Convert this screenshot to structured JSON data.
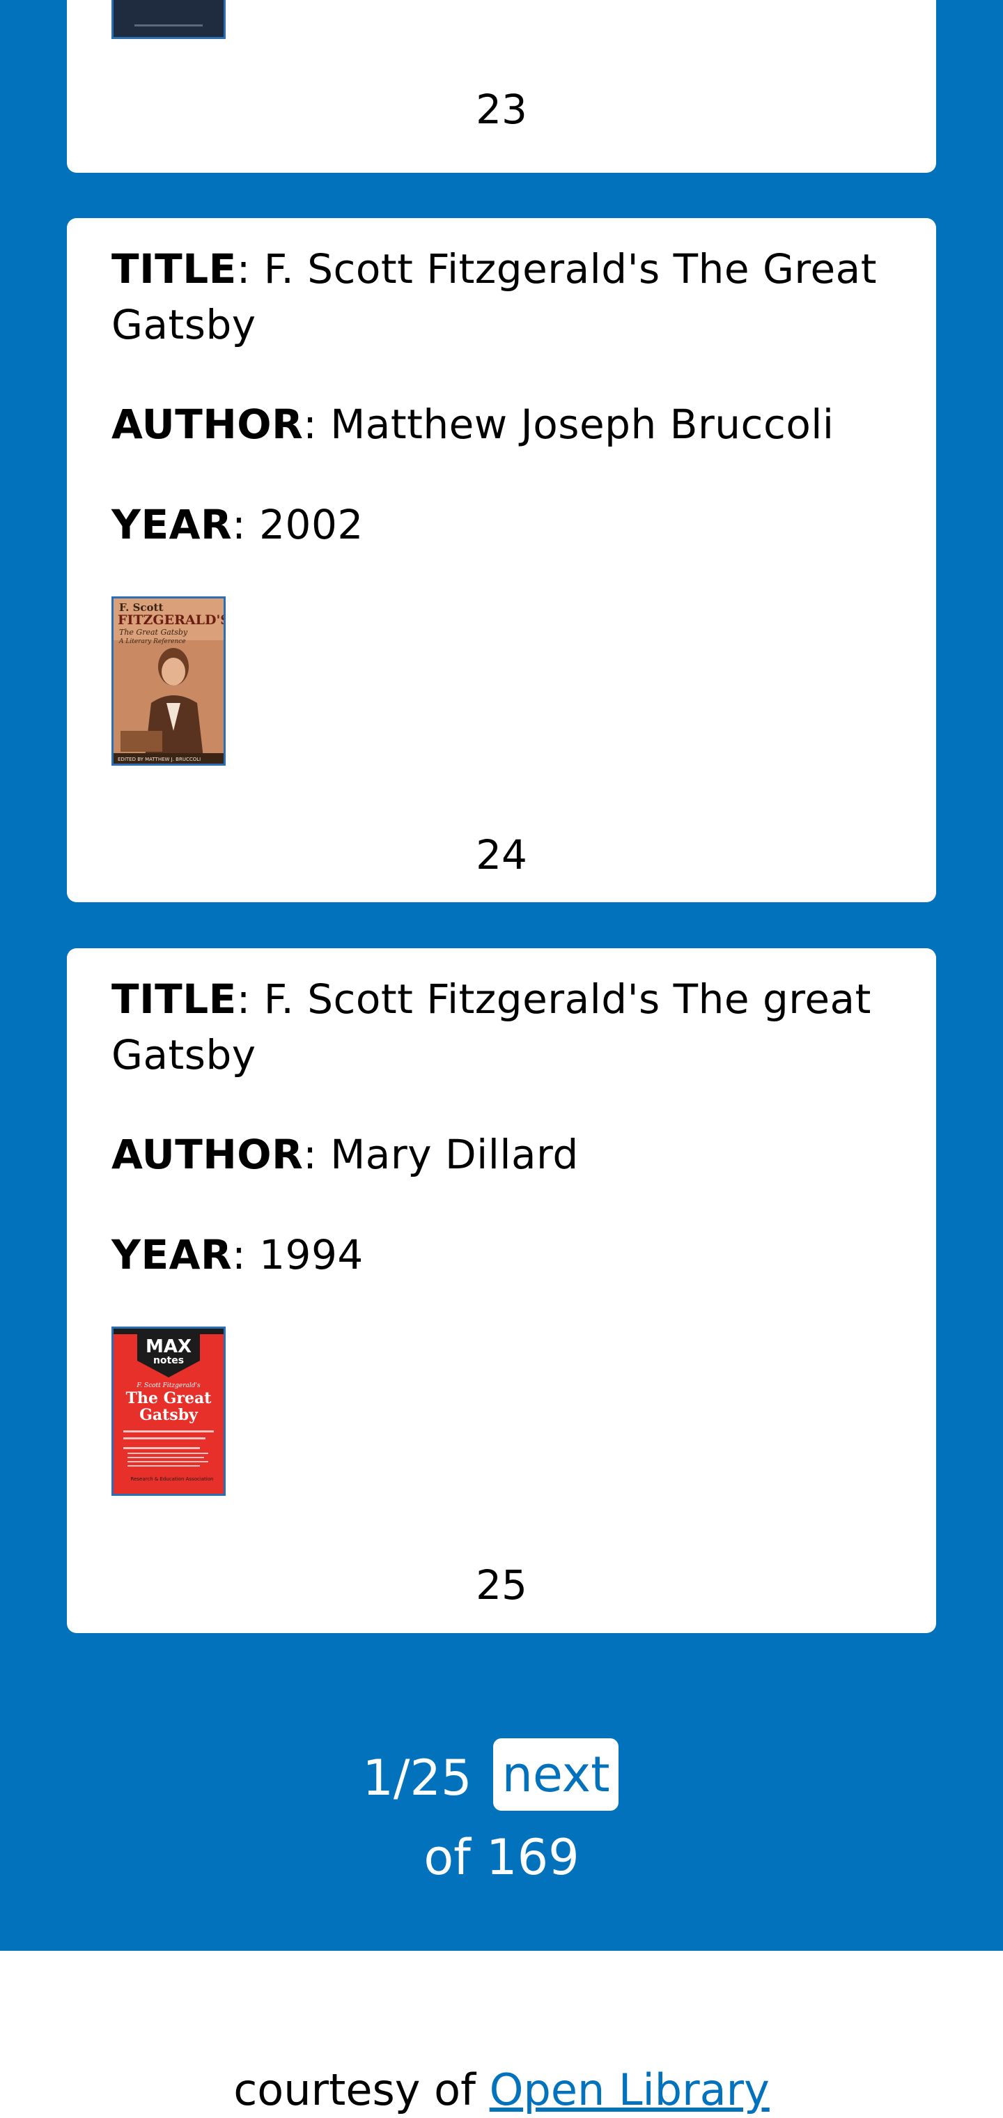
{
  "colors": {
    "page_blue": "#0272bd",
    "card_bg": "#ffffff",
    "link": "#0272bd"
  },
  "books": [
    {
      "index": "23"
    },
    {
      "title_label": "TITLE",
      "title": "F. Scott Fitzgerald's The Great Gatsby",
      "author_label": "AUTHOR",
      "author": "Matthew Joseph Bruccoli",
      "year_label": "YEAR",
      "year": "2002",
      "cover": {
        "top_line": "F. Scott",
        "name": "FITZGERALD'S",
        "subtitle": "The Great Gatsby",
        "subtitle2": "A Literary Reference",
        "editor": "EDITED BY MATTHEW J. BRUCCOLI"
      },
      "index": "24"
    },
    {
      "title_label": "TITLE",
      "title": "F. Scott Fitzgerald's The great Gatsby",
      "author_label": "AUTHOR",
      "author": "Mary Dillard",
      "year_label": "YEAR",
      "year": "1994",
      "cover": {
        "logo_top": "MAX",
        "logo_bottom": "notes",
        "by_line": "F. Scott Fitzgerald's",
        "title_line1": "The Great",
        "title_line2": "Gatsby",
        "publisher": "Research & Education Association"
      },
      "index": "25"
    }
  ],
  "pagination": {
    "current": "1/25",
    "next_label": "next",
    "total": "of 169"
  },
  "footer": {
    "prefix": "courtesy of",
    "link_text": "Open Library"
  }
}
